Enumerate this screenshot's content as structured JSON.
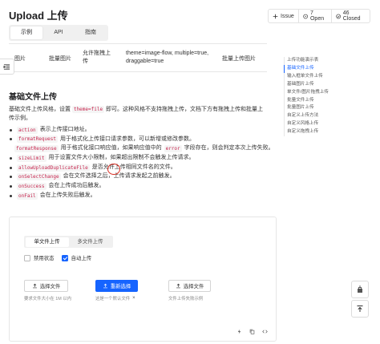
{
  "page": {
    "title": "Upload 上传"
  },
  "tabs": [
    {
      "label": "示例",
      "active": true
    },
    {
      "label": "API",
      "active": false
    },
    {
      "label": "指南",
      "active": false
    }
  ],
  "issues": {
    "issue_label": "Issue",
    "open_label": "7 Open",
    "closed_label": "46 Closed"
  },
  "api_table": {
    "cells": [
      "图片",
      "批量图片",
      "允许拖拽上传",
      "theme=image-flow, multiple=true, draggable=true",
      "批量上传图片"
    ]
  },
  "section": {
    "title": "基础文件上传",
    "desc_prefix": "基础文件上传风格，设置",
    "desc_code": "theme=file",
    "desc_suffix": "即可。这种风格不支持拖拽上传，文档下方有拖拽上传和批量上传示例。"
  },
  "features": [
    {
      "code": "action",
      "text": "表示上传接口地址。"
    },
    {
      "code": "formatRequest",
      "text": "用于格式化上传接口请求参数，可以新增或修改参数。"
    },
    {
      "code": "formatResponse",
      "text_a": "用于格式化接口响应值，如果响应值中的",
      "code2": "error",
      "text_b": "字段存在，则会判定本次上传失败。"
    },
    {
      "code": "sizeLimit",
      "text": "用于设置文件大小限制，如果超出限制不会触发上传请求。"
    },
    {
      "code": "allowUploadDuplicateFile",
      "text": "是否允许上传相同文件名的文件。"
    },
    {
      "code": "onSelectChange",
      "text": "会在文件选择之后，上传请求发起之前触发。"
    },
    {
      "code": "onSuccess",
      "text": "会在上传成功后触发。"
    },
    {
      "code": "onFail",
      "text": "会在上传失败后触发。"
    }
  ],
  "toc": [
    {
      "label": "上传功能演示表",
      "active": false
    },
    {
      "label": "基础文件上传",
      "active": true
    },
    {
      "label": "输入框单文件上传",
      "active": false
    },
    {
      "label": "基础图片上传",
      "active": false
    },
    {
      "label": "单文件/图片拖拽上传",
      "active": false
    },
    {
      "label": "批量文件上传",
      "active": false
    },
    {
      "label": "批量图片上传",
      "active": false
    },
    {
      "label": "自定义上传方法",
      "active": false
    },
    {
      "label": "自定义风格上传",
      "active": false
    },
    {
      "label": "自定义拖拽上传",
      "active": false
    }
  ],
  "demo": {
    "mini_tabs": [
      {
        "label": "单文件上传",
        "active": true
      },
      {
        "label": "多文件上传",
        "active": false
      }
    ],
    "checks": [
      {
        "label": "禁用状态",
        "checked": false
      },
      {
        "label": "自动上传",
        "checked": true
      }
    ],
    "buttons": [
      {
        "label": "选择文件",
        "hint": "要求文件大小在 1M 以内",
        "primary": false
      },
      {
        "label": "重新选择",
        "hint": "这是一个默认文件",
        "primary": true
      },
      {
        "label": "选择文件",
        "hint": "文件上传失败示例",
        "primary": false
      }
    ]
  },
  "colors": {
    "accent": "#1664ff",
    "code": "#c7254e",
    "annotation": "#d93025"
  }
}
